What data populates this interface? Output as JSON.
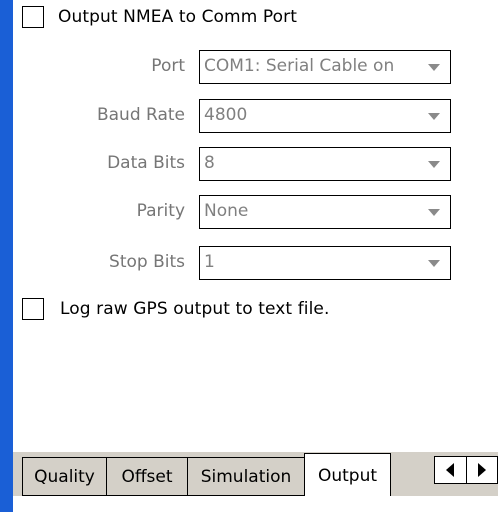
{
  "output_nmea": {
    "label": "Output NMEA to Comm Port",
    "checked": false
  },
  "fields": {
    "port": {
      "label": "Port",
      "value": "COM1: Serial Cable on"
    },
    "baud_rate": {
      "label": "Baud Rate",
      "value": "4800"
    },
    "data_bits": {
      "label": "Data Bits",
      "value": "8"
    },
    "parity": {
      "label": "Parity",
      "value": "None"
    },
    "stop_bits": {
      "label": "Stop Bits",
      "value": "1"
    }
  },
  "log_raw": {
    "label": "Log raw GPS output to text file.",
    "checked": false
  },
  "tabs": [
    {
      "label": "Quality"
    },
    {
      "label": "Offset"
    },
    {
      "label": "Simulation"
    },
    {
      "label": "Output",
      "active": true
    }
  ],
  "colors": {
    "left_bar": "#1a5fd6",
    "tab_bg": "#d4d0c8",
    "disabled_text": "#767676"
  },
  "icons": {
    "scroll_left": "triangle-left-icon",
    "scroll_right": "triangle-right-icon",
    "dropdown": "chevron-down-icon"
  }
}
